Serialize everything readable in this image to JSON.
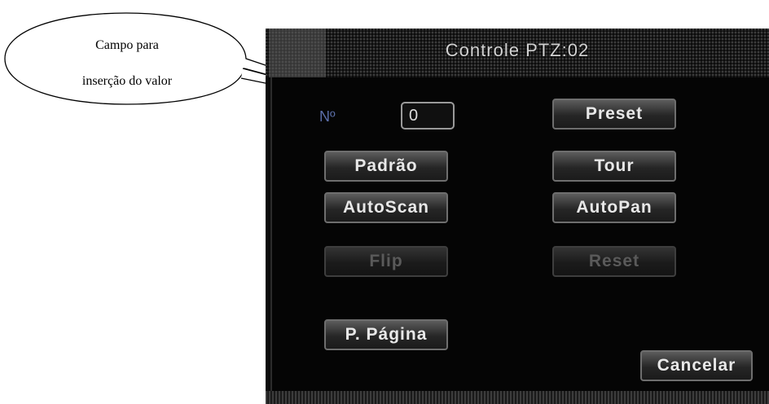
{
  "callout": {
    "line1": "Campo para",
    "line2": "inserção do valor"
  },
  "dialog": {
    "title": "Controle PTZ:02",
    "number_label": "Nº",
    "number_value": "0",
    "buttons": {
      "preset": "Preset",
      "padrao": "Padrão",
      "tour": "Tour",
      "autoscan": "AutoScan",
      "autopan": "AutoPan",
      "flip": "Flip",
      "reset": "Reset",
      "proxima_pagina": "P. Página",
      "cancelar": "Cancelar"
    }
  }
}
